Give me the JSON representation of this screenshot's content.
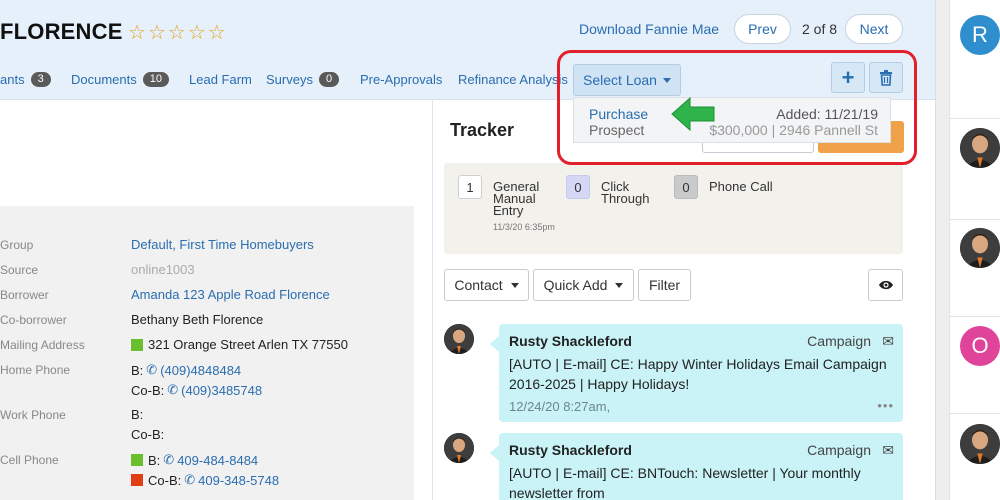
{
  "header": {
    "title": "FLORENCE",
    "rating_stars": 5,
    "download_link": "Download Fannie Mae",
    "prev_label": "Prev",
    "pager_text": "2 of 8",
    "next_label": "Next"
  },
  "tabs": [
    {
      "label": "ants",
      "badge": "3"
    },
    {
      "label": "Documents",
      "badge": "10"
    },
    {
      "label": "Lead Farm",
      "badge": ""
    },
    {
      "label": "Surveys",
      "badge": "0"
    },
    {
      "label": "Pre-Approvals",
      "badge": ""
    },
    {
      "label": "Refinance Analysis",
      "badge": ""
    }
  ],
  "loan_select": {
    "label": "Select Loan",
    "add_icon": "plus-icon",
    "delete_icon": "trash-icon",
    "dropdown": {
      "loan_type": "Purchase",
      "loan_status": "Prospect",
      "added": "Added: 11/21/19",
      "summary": "$300,000 | 2946 Pannell St"
    }
  },
  "contact_info": {
    "group_label": "Group",
    "group_value": "Default, First Time Homebuyers",
    "source_label": "Source",
    "source_value": "online1003",
    "borrower_label": "Borrower",
    "borrower_value": "Amanda 123 Apple Road Florence",
    "coborrower_label": "Co-borrower",
    "coborrower_value": "Bethany Beth Florence",
    "mailing_label": "Mailing Address",
    "mailing_value": "321 Orange Street Arlen TX 77550",
    "home_label": "Home Phone",
    "home_b_prefix": "B:",
    "home_b_value": "(409)4848484",
    "home_cob_prefix": "Co-B:",
    "home_cob_value": "(409)3485748",
    "work_label": "Work Phone",
    "work_b_prefix": "B:",
    "work_cob_prefix": "Co-B:",
    "cell_label": "Cell Phone",
    "cell_b_prefix": "B:",
    "cell_b_value": "409-484-8484",
    "cell_cob_prefix": "Co-B:",
    "cell_cob_value": "409-348-5748"
  },
  "tracker": {
    "title": "Tracker",
    "stats": [
      {
        "count": "1",
        "label_lines": [
          "General",
          "Manual",
          "Entry"
        ]
      },
      {
        "count": "0",
        "label_lines": [
          "Click",
          "Through"
        ]
      },
      {
        "count": "0",
        "label_lines": [
          "Phone Call"
        ]
      }
    ],
    "stat_time": "11/3/20 6:35pm",
    "contact_btn": "Contact",
    "quick_add_btn": "Quick Add",
    "filter_btn": "Filter",
    "activities": [
      {
        "author": "Rusty Shackleford",
        "type": "Campaign",
        "body": "[AUTO | E-mail] CE: Happy Winter Holidays Email Campaign 2016-2025 | Happy Holidays!",
        "date": "12/24/20 8:27am,",
        "more": "•••"
      },
      {
        "author": "Rusty Shackleford",
        "type": "Campaign",
        "body": "[AUTO | E-mail] CE: BNTouch: Newsletter | Your monthly newsletter from",
        "date": "",
        "more": ""
      }
    ]
  },
  "right_bar": {
    "avatar_1_letter": "R",
    "avatar_4_letter": "O",
    "color_r": "#2f8fce",
    "color_o": "#e0449a"
  },
  "colors": {
    "link": "#2a6db0",
    "highlight_outline": "#e2202b",
    "arrow": "#2fb34a"
  }
}
